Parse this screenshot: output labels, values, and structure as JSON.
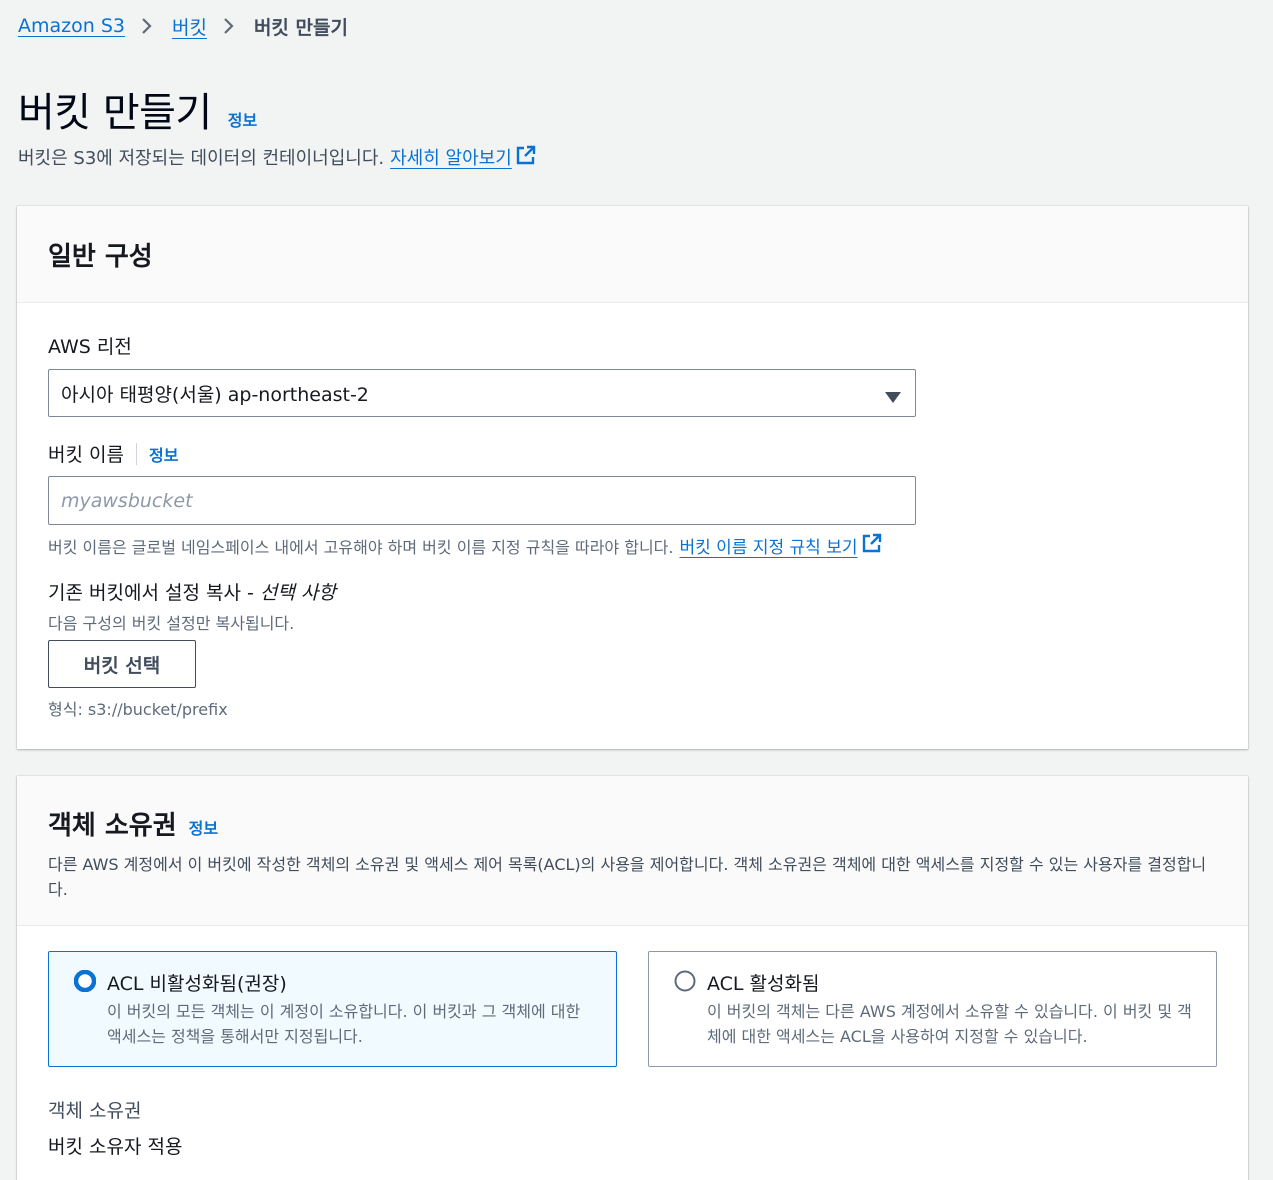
{
  "breadcrumb": {
    "items": [
      "Amazon S3",
      "버킷"
    ],
    "current": "버킷 만들기"
  },
  "page": {
    "title": "버킷 만들기",
    "info": "정보",
    "description": "버킷은 S3에 저장되는 데이터의 컨테이너입니다.",
    "learn_more": "자세히 알아보기"
  },
  "general": {
    "heading": "일반 구성",
    "region_label": "AWS 리전",
    "region_value": "아시아 태평양(서울) ap-northeast-2",
    "bucket_name_label": "버킷 이름",
    "bucket_name_info": "정보",
    "bucket_name_placeholder": "myawsbucket",
    "bucket_name_hint": "버킷 이름은 글로벌 네임스페이스 내에서 고유해야 하며 버킷 이름 지정 규칙을 따라야 합니다.",
    "naming_rules_link": "버킷 이름 지정 규칙 보기",
    "copy_label": "기존 버킷에서 설정 복사 - ",
    "copy_label_optional": "선택 사항",
    "copy_desc": "다음 구성의 버킷 설정만 복사됩니다.",
    "choose_bucket_button": "버킷 선택",
    "format_hint": "형식: s3://bucket/prefix"
  },
  "ownership": {
    "heading": "객체 소유권",
    "info": "정보",
    "description": "다른 AWS 계정에서 이 버킷에 작성한 객체의 소유권 및 액세스 제어 목록(ACL)의 사용을 제어합니다. 객체 소유권은 객체에 대한 액세스를 지정할 수 있는 사용자를 결정합니다.",
    "options": [
      {
        "title": "ACL 비활성화됨(권장)",
        "desc": "이 버킷의 모든 객체는 이 계정이 소유합니다. 이 버킷과 그 객체에 대한 액세스는 정책을 통해서만 지정됩니다.",
        "selected": true
      },
      {
        "title": "ACL 활성화됨",
        "desc": "이 버킷의 객체는 다른 AWS 계정에서 소유할 수 있습니다. 이 버킷 및 객체에 대한 액세스는 ACL을 사용하여 지정할 수 있습니다.",
        "selected": false
      }
    ],
    "field_label": "객체 소유권",
    "field_value": "버킷 소유자 적용"
  }
}
